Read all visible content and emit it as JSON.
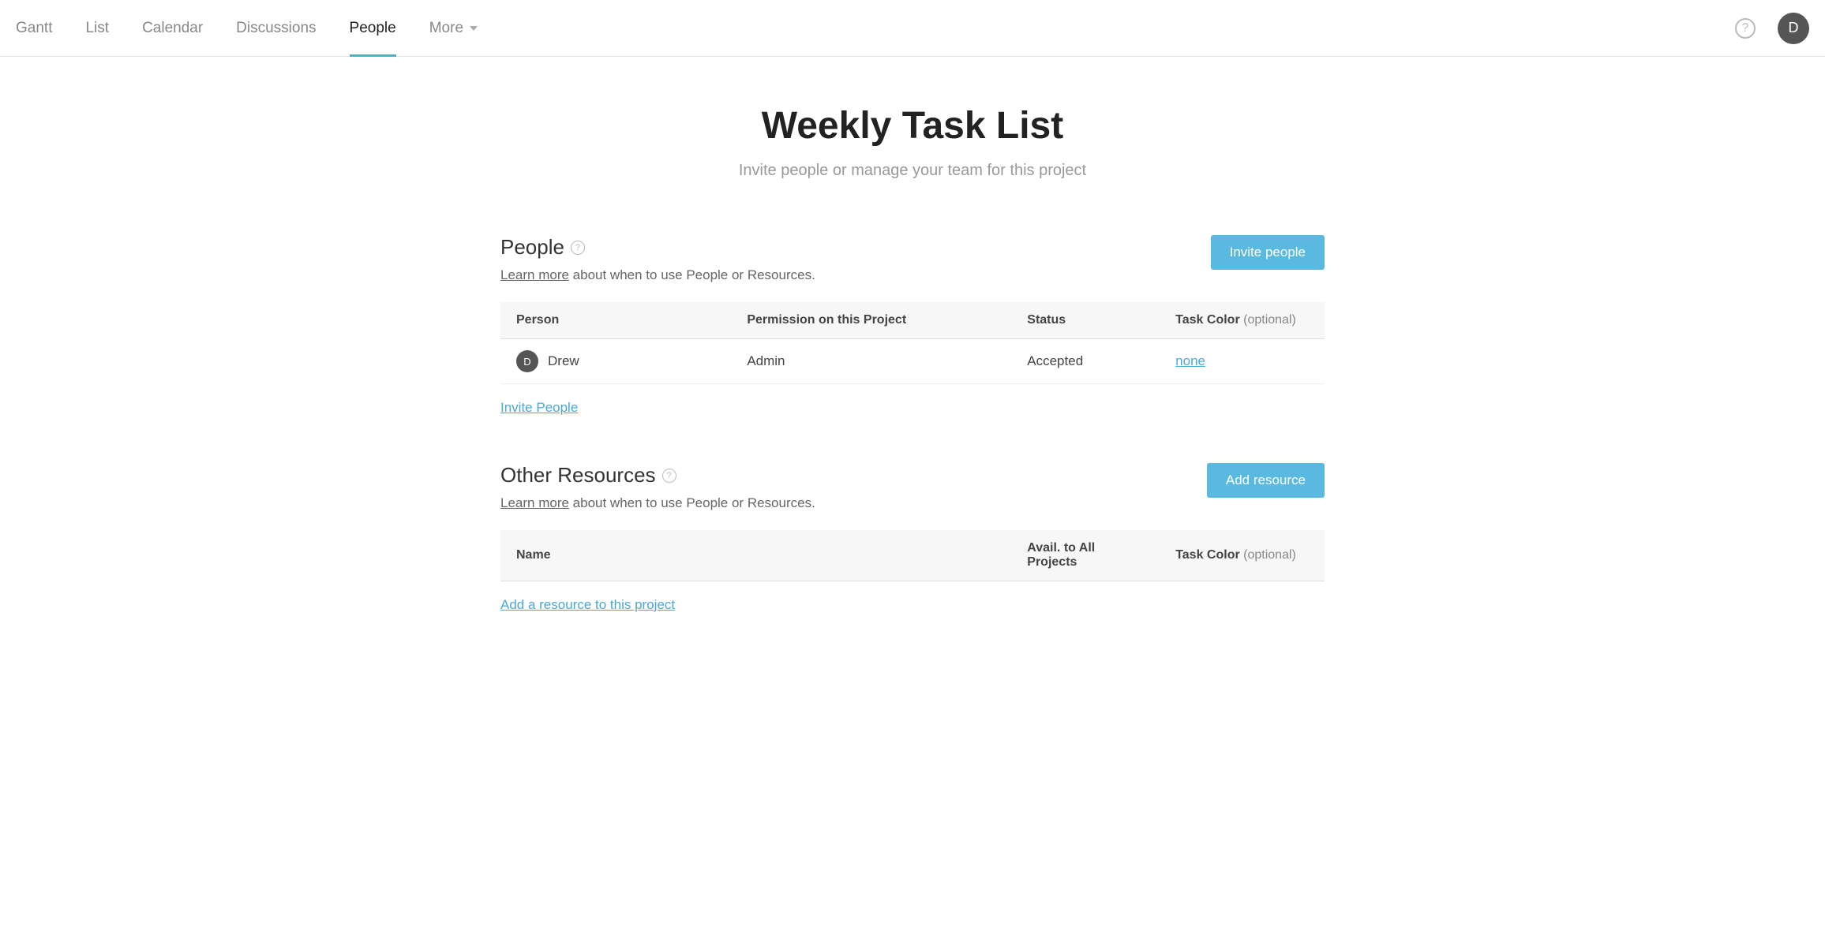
{
  "nav": {
    "tabs": [
      {
        "label": "Gantt",
        "active": false
      },
      {
        "label": "List",
        "active": false
      },
      {
        "label": "Calendar",
        "active": false
      },
      {
        "label": "Discussions",
        "active": false
      },
      {
        "label": "People",
        "active": true
      },
      {
        "label": "More",
        "active": false,
        "dropdown": true
      }
    ],
    "avatar_initial": "D",
    "help_glyph": "?"
  },
  "header": {
    "title": "Weekly Task List",
    "subtitle": "Invite people or manage your team for this project"
  },
  "people_section": {
    "title": "People",
    "learn_more": "Learn more",
    "desc_rest": " about when to use People or Resources.",
    "button": "Invite people",
    "columns": {
      "person": "Person",
      "permission": "Permission on this Project",
      "status": "Status",
      "task_color": "Task Color",
      "optional": "(optional)"
    },
    "rows": [
      {
        "initial": "D",
        "name": "Drew",
        "permission": "Admin",
        "status": "Accepted",
        "color": "none"
      }
    ],
    "footer_link": "Invite People"
  },
  "resources_section": {
    "title": "Other Resources",
    "learn_more": "Learn more",
    "desc_rest": " about when to use People or Resources.",
    "button": "Add resource",
    "columns": {
      "name": "Name",
      "avail": "Avail. to All Projects",
      "task_color": "Task Color",
      "optional": "(optional)"
    },
    "footer_link": "Add a resource to this project"
  }
}
